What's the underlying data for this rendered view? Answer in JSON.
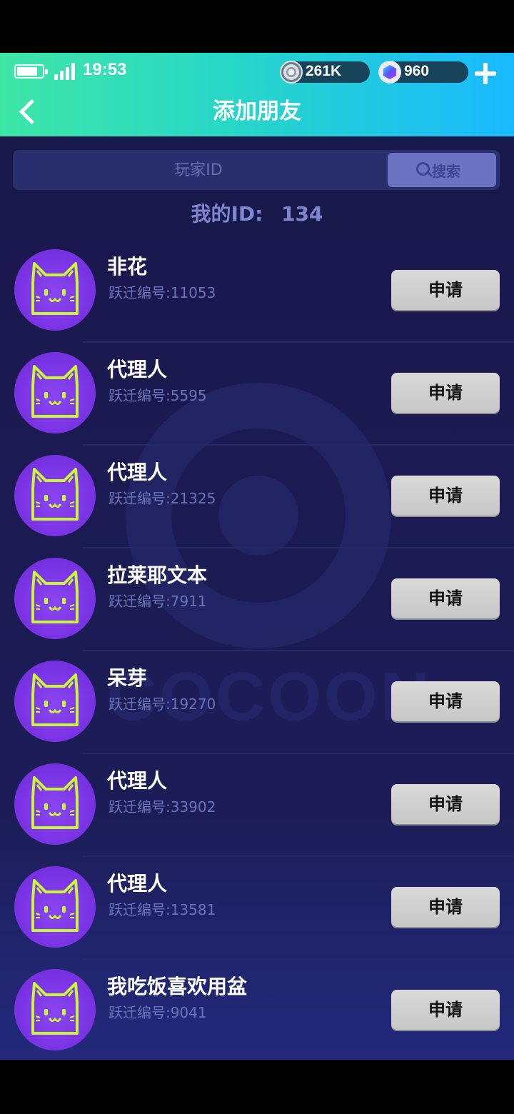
{
  "status_bar": {
    "time": "19:53",
    "coins": "261K",
    "gems": "960"
  },
  "header": {
    "title": "添加朋友"
  },
  "search": {
    "placeholder": "玩家ID",
    "button_label": "搜索"
  },
  "my_id": {
    "label": "我的ID:",
    "value": "134"
  },
  "watermark": "COCOON",
  "friends": [
    {
      "name": "非花",
      "sub": "跃迁编号:11053",
      "action": "申请"
    },
    {
      "name": "代理人",
      "sub": "跃迁编号:5595",
      "action": "申请"
    },
    {
      "name": "代理人",
      "sub": "跃迁编号:21325",
      "action": "申请"
    },
    {
      "name": "拉莱耶文本",
      "sub": "跃迁编号:7911",
      "action": "申请"
    },
    {
      "name": "呆芽",
      "sub": "跃迁编号:19270",
      "action": "申请"
    },
    {
      "name": "代理人",
      "sub": "跃迁编号:33902",
      "action": "申请"
    },
    {
      "name": "代理人",
      "sub": "跃迁编号:13581",
      "action": "申请"
    },
    {
      "name": "我吃饭喜欢用盆",
      "sub": "跃迁编号:9041",
      "action": "申请"
    }
  ],
  "colors": {
    "header_gradient_start": "#3ee6a6",
    "header_gradient_end": "#1ab9ff",
    "background": "#1a1850",
    "avatar": "#7a33e4",
    "button": "#d0d0d0"
  }
}
